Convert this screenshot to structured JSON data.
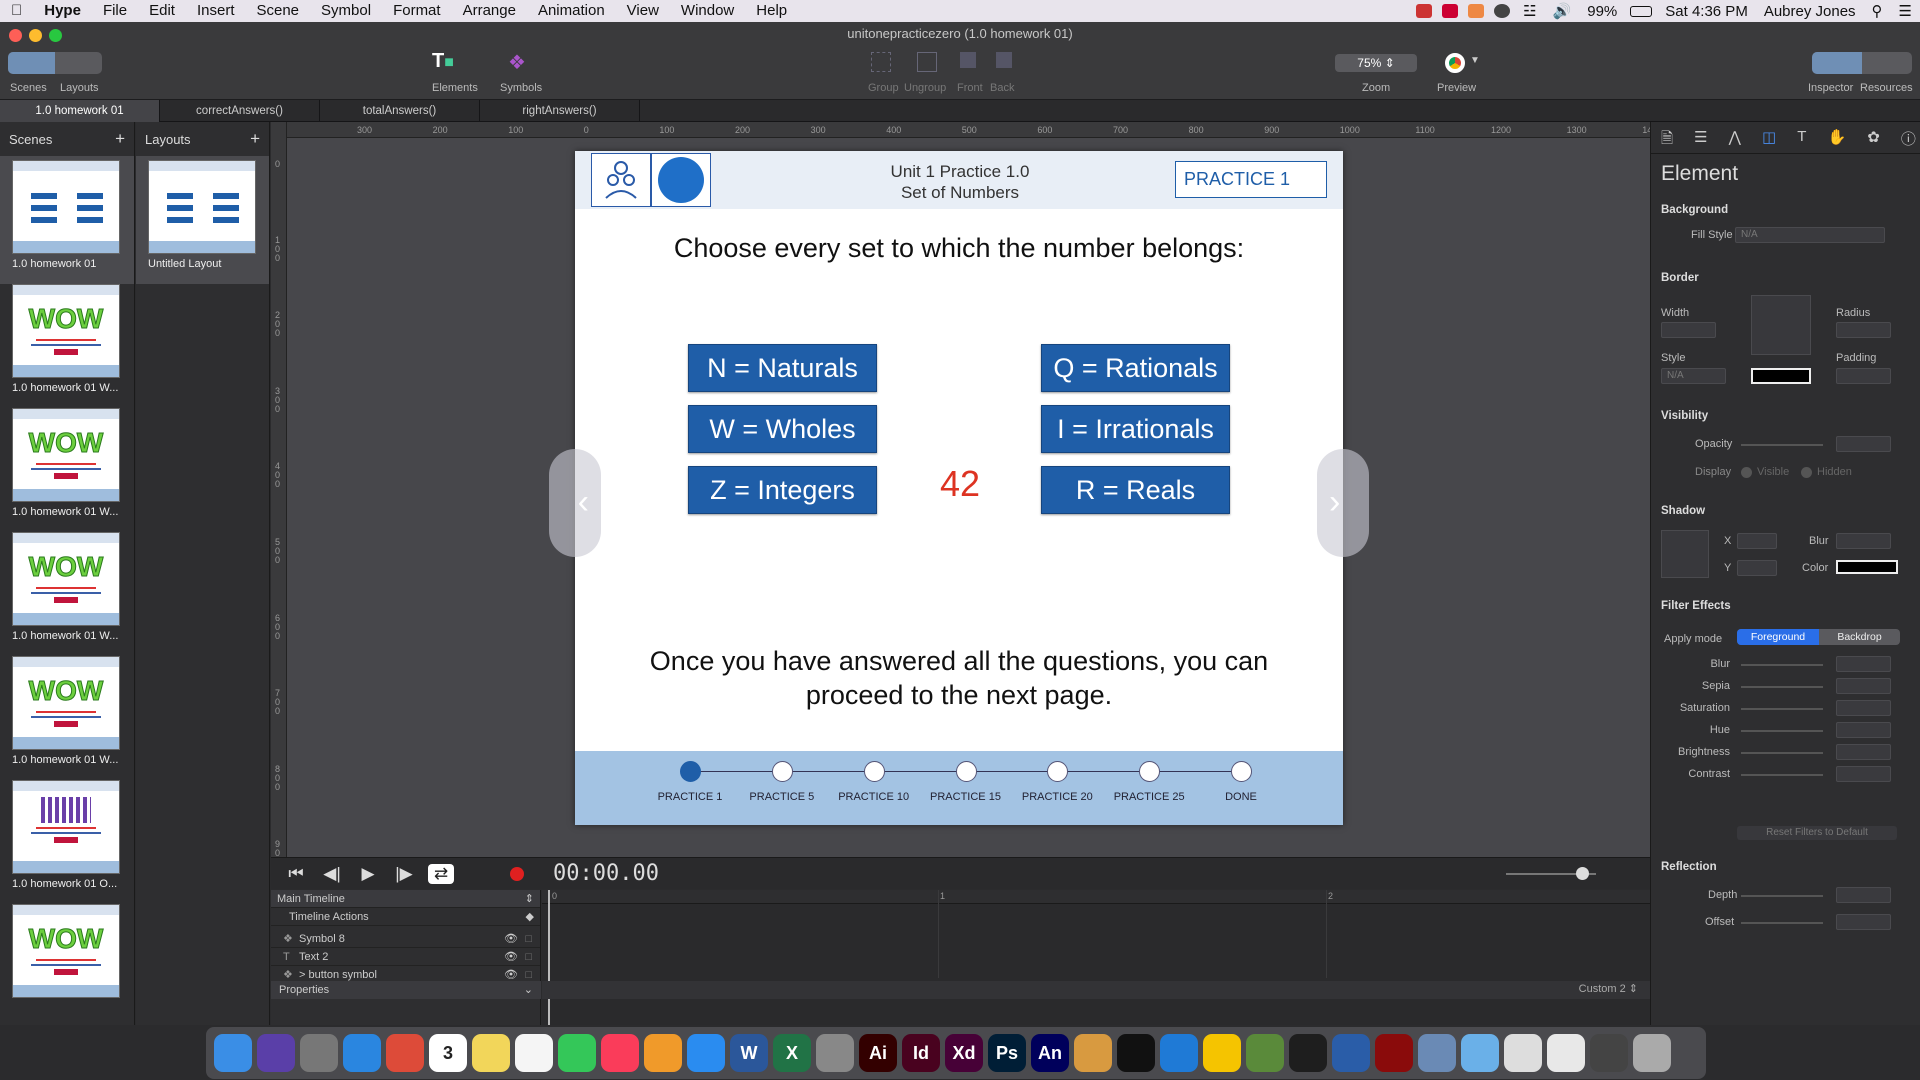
{
  "menubar": {
    "app": "Hype",
    "items": [
      "File",
      "Edit",
      "Insert",
      "Scene",
      "Symbol",
      "Format",
      "Arrange",
      "Animation",
      "View",
      "Window",
      "Help"
    ],
    "battery": "99%",
    "clock": "Sat 4:36 PM",
    "user": "Aubrey Jones"
  },
  "toolbar": {
    "doc_title": "unitonepracticezero (1.0 homework 01)",
    "scenes": "Scenes",
    "layouts": "Layouts",
    "elements": "Elements",
    "symbols": "Symbols",
    "group": "Group",
    "ungroup": "Ungroup",
    "front": "Front",
    "back": "Back",
    "zoom_value": "75%",
    "zoom": "Zoom",
    "preview": "Preview",
    "inspector": "Inspector",
    "resources": "Resources"
  },
  "tabs": [
    "1.0 homework 01",
    "correctAnswers()",
    "totalAnswers()",
    "rightAnswers()"
  ],
  "scenes_panel": {
    "title": "Scenes",
    "items": [
      {
        "label": "1.0 homework 01",
        "kind": "main"
      },
      {
        "label": "1.0 homework 01 W...",
        "kind": "wow"
      },
      {
        "label": "1.0 homework 01 W...",
        "kind": "wow"
      },
      {
        "label": "1.0 homework 01 W...",
        "kind": "wow"
      },
      {
        "label": "1.0 homework 01 W...",
        "kind": "wow"
      },
      {
        "label": "1.0 homework 01 O...",
        "kind": "oops"
      },
      {
        "label": "",
        "kind": "wow"
      }
    ],
    "wow_text": "WOW"
  },
  "layouts_panel": {
    "title": "Layouts",
    "items": [
      {
        "label": "Untitled Layout"
      }
    ]
  },
  "ruler": {
    "h": [
      "300",
      "200",
      "100",
      "0",
      "100",
      "200",
      "300",
      "400",
      "500",
      "600",
      "700",
      "800",
      "900",
      "1000",
      "1100",
      "1200",
      "1300",
      "1400"
    ],
    "v": [
      "0",
      "100",
      "200",
      "300",
      "400",
      "500",
      "600",
      "700",
      "800",
      "900"
    ]
  },
  "scene": {
    "unit_title_1": "Unit 1 Practice 1.0",
    "unit_title_2": "Set of Numbers",
    "practice_box": "PRACTICE 1",
    "instruction": "Choose every set to which the number belongs:",
    "number": "42",
    "buttons": [
      "N = Naturals",
      "W = Wholes",
      "Z = Integers",
      "Q = Rationals",
      "I = Irrationals",
      "R = Reals"
    ],
    "closing": "Once you have answered all the questions, you can proceed to the next page.",
    "progress": [
      "PRACTICE 1",
      "PRACTICE 5",
      "PRACTICE 10",
      "PRACTICE 15",
      "PRACTICE 20",
      "PRACTICE 25",
      "DONE"
    ],
    "progress_current": 0
  },
  "timeline": {
    "timecode": "00:00.00",
    "main_timeline": "Main Timeline",
    "timeline_actions": "Timeline Actions",
    "layers": [
      "Symbol 8",
      "Text 2",
      "> button symbol"
    ],
    "properties": "Properties",
    "custom": "Custom 2",
    "ticks": [
      "0",
      "1",
      "2"
    ]
  },
  "inspector": {
    "title": "Element",
    "background": "Background",
    "fill_style": "Fill Style",
    "fill_value": "N/A",
    "border": "Border",
    "width": "Width",
    "radius": "Radius",
    "style": "Style",
    "style_value": "N/A",
    "padding": "Padding",
    "visibility": "Visibility",
    "opacity": "Opacity",
    "display": "Display",
    "visible": "Visible",
    "hidden": "Hidden",
    "shadow": "Shadow",
    "x": "X",
    "y": "Y",
    "blur": "Blur",
    "color": "Color",
    "filter_effects": "Filter Effects",
    "apply_mode": "Apply mode",
    "foreground": "Foreground",
    "backdrop": "Backdrop",
    "filters": [
      "Blur",
      "Sepia",
      "Saturation",
      "Hue",
      "Brightness",
      "Contrast"
    ],
    "reset": "Reset Filters to Default",
    "reflection": "Reflection",
    "depth": "Depth",
    "offset": "Offset"
  },
  "dock": {
    "apps": [
      {
        "name": "Finder",
        "color": "#3a8ee6"
      },
      {
        "name": "Siri",
        "color": "#5a3fa8"
      },
      {
        "name": "Launchpad",
        "color": "#777"
      },
      {
        "name": "Safari",
        "color": "#2a86e0"
      },
      {
        "name": "Chrome",
        "color": "#dd4b39"
      },
      {
        "name": "Calendar",
        "color": "#ffffff"
      },
      {
        "name": "Notes",
        "color": "#f2d65a"
      },
      {
        "name": "Reminders",
        "color": "#f5f5f5"
      },
      {
        "name": "Messages",
        "color": "#34c759"
      },
      {
        "name": "Music",
        "color": "#fa3c5a"
      },
      {
        "name": "Books",
        "color": "#f09a2a"
      },
      {
        "name": "App Store",
        "color": "#2a8cf0"
      },
      {
        "name": "Word",
        "color": "#2b579a"
      },
      {
        "name": "Excel",
        "color": "#217346"
      },
      {
        "name": "System Preferences",
        "color": "#888"
      },
      {
        "name": "Illustrator",
        "color": "#330000"
      },
      {
        "name": "InDesign",
        "color": "#49021f"
      },
      {
        "name": "XD",
        "color": "#470137"
      },
      {
        "name": "Photoshop",
        "color": "#001e36"
      },
      {
        "name": "Animate",
        "color": "#00005b"
      },
      {
        "name": "Hype",
        "color": "#d89a40"
      },
      {
        "name": "Terminal",
        "color": "#111"
      },
      {
        "name": "VS Code",
        "color": "#1f7ad6"
      },
      {
        "name": "Cyberduck",
        "color": "#f5c400"
      },
      {
        "name": "Minecraft",
        "color": "#5a8a3a"
      },
      {
        "name": "Figma",
        "color": "#1e1e1e"
      },
      {
        "name": "QuickTime",
        "color": "#2a5da8"
      },
      {
        "name": "Flash",
        "color": "#8a0b0b"
      },
      {
        "name": "Preview",
        "color": "#6a8ab5"
      },
      {
        "name": "Downloads",
        "color": "#6ab0e8"
      },
      {
        "name": "Docs",
        "color": "#ddd"
      },
      {
        "name": "Files",
        "color": "#e8e8e8"
      },
      {
        "name": "Screen",
        "color": "#444"
      },
      {
        "name": "Trash",
        "color": "#aaa"
      }
    ],
    "labels": {
      "Illustrator": "Ai",
      "InDesign": "Id",
      "XD": "Xd",
      "Photoshop": "Ps",
      "Animate": "An",
      "Word": "W",
      "Excel": "X",
      "Calendar": "3"
    }
  }
}
